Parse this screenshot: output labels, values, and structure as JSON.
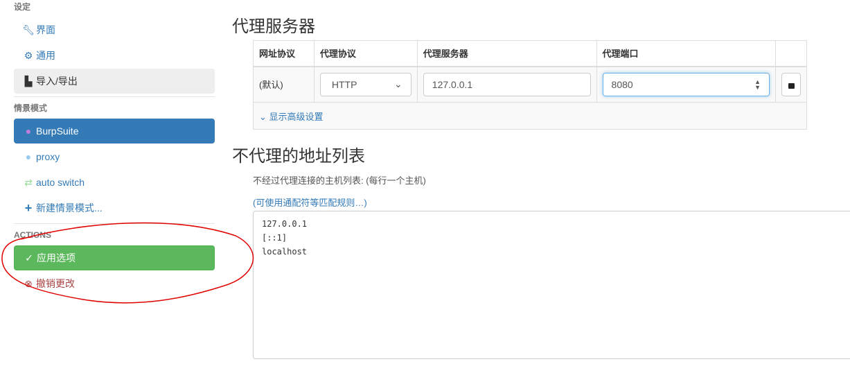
{
  "sidebar": {
    "settings_header": "设定",
    "settings": [
      {
        "label": "界面",
        "icon": "wrench-icon"
      },
      {
        "label": "通用",
        "icon": "gear-icon"
      },
      {
        "label": "导入/导出",
        "icon": "floppy-icon"
      }
    ],
    "profiles_header": "情景模式",
    "profiles": [
      {
        "label": "BurpSuite",
        "icon": "globe-icon",
        "color": "#c17ddb"
      },
      {
        "label": "proxy",
        "icon": "globe-icon",
        "color": "#99ccee"
      },
      {
        "label": "auto switch",
        "icon": "retweet-icon",
        "color": "#99dd99"
      }
    ],
    "new_profile": "新建情景模式...",
    "actions_header": "ACTIONS",
    "apply": "应用选项",
    "discard": "撤销更改"
  },
  "proxy": {
    "title": "代理服务器",
    "columns": [
      "网址协议",
      "代理协议",
      "代理服务器",
      "代理端口"
    ],
    "row": {
      "scheme": "(默认)",
      "protocol": "HTTP",
      "server": "127.0.0.1",
      "port": "8080"
    },
    "advanced": "显示高级设置"
  },
  "bypass": {
    "title": "不代理的地址列表",
    "desc": "不经过代理连接的主机列表: (每行一个主机)",
    "wildcard_link": "(可使用通配符等匹配规则…)",
    "value": "127.0.0.1\n[::1]\nlocalhost"
  },
  "colors": {
    "primary": "#337ab7",
    "success": "#5cb85c",
    "danger": "#a94442",
    "annotation": "#e00000"
  }
}
